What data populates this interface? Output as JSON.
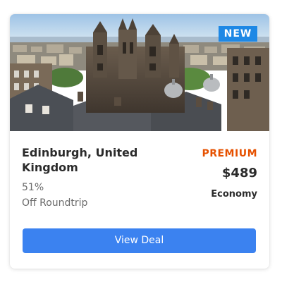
{
  "deal": {
    "badge": "NEW",
    "destination": "Edinburgh, United Kingdom",
    "discount_percent": "51%",
    "discount_label": "Off Roundtrip",
    "tier": "PREMIUM",
    "price": "$489",
    "cabin_class": "Economy",
    "cta_label": "View Deal"
  },
  "colors": {
    "badge_bg": "#1e88e5",
    "tier_text": "#e65100",
    "cta_bg": "#3b82f0"
  }
}
